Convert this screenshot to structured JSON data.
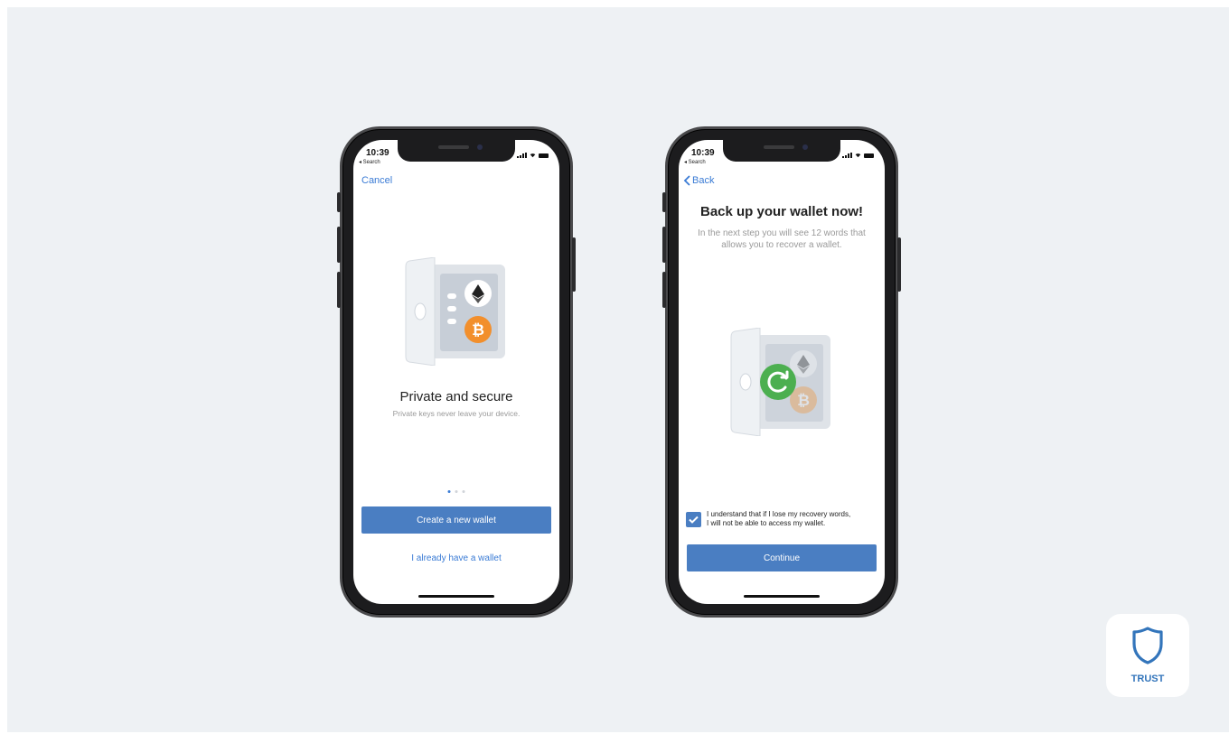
{
  "colors": {
    "background": "#eef1f4",
    "accent": "#4a7ec2",
    "link": "#3a7bd5",
    "success": "#4caf50",
    "brand": "#3375bb"
  },
  "phone1": {
    "status": {
      "time": "10:39",
      "back": "◂ Search"
    },
    "nav": {
      "cancel": "Cancel"
    },
    "illustration": {
      "icons": [
        "vault-icon",
        "ethereum-icon",
        "bitcoin-icon"
      ]
    },
    "title": "Private and secure",
    "subtitle": "Private keys never leave your device.",
    "pagination": {
      "total": 3,
      "active": 0
    },
    "primary_button": "Create a new wallet",
    "secondary_link": "I already have a wallet"
  },
  "phone2": {
    "status": {
      "time": "10:39",
      "back": "◂ Search"
    },
    "nav": {
      "back": "Back"
    },
    "title": "Back up your wallet now!",
    "subtitle": "In the next step you will see 12 words that allows you to recover a wallet.",
    "illustration": {
      "icons": [
        "vault-icon",
        "refresh-icon",
        "ethereum-icon",
        "bitcoin-icon"
      ]
    },
    "checkbox": {
      "checked": true,
      "label_line1": "I understand that if I lose my recovery words,",
      "label_line2": "I will not be able to access my wallet."
    },
    "continue_button": "Continue"
  },
  "brand": {
    "label": "TRUST",
    "icon": "shield-icon"
  }
}
